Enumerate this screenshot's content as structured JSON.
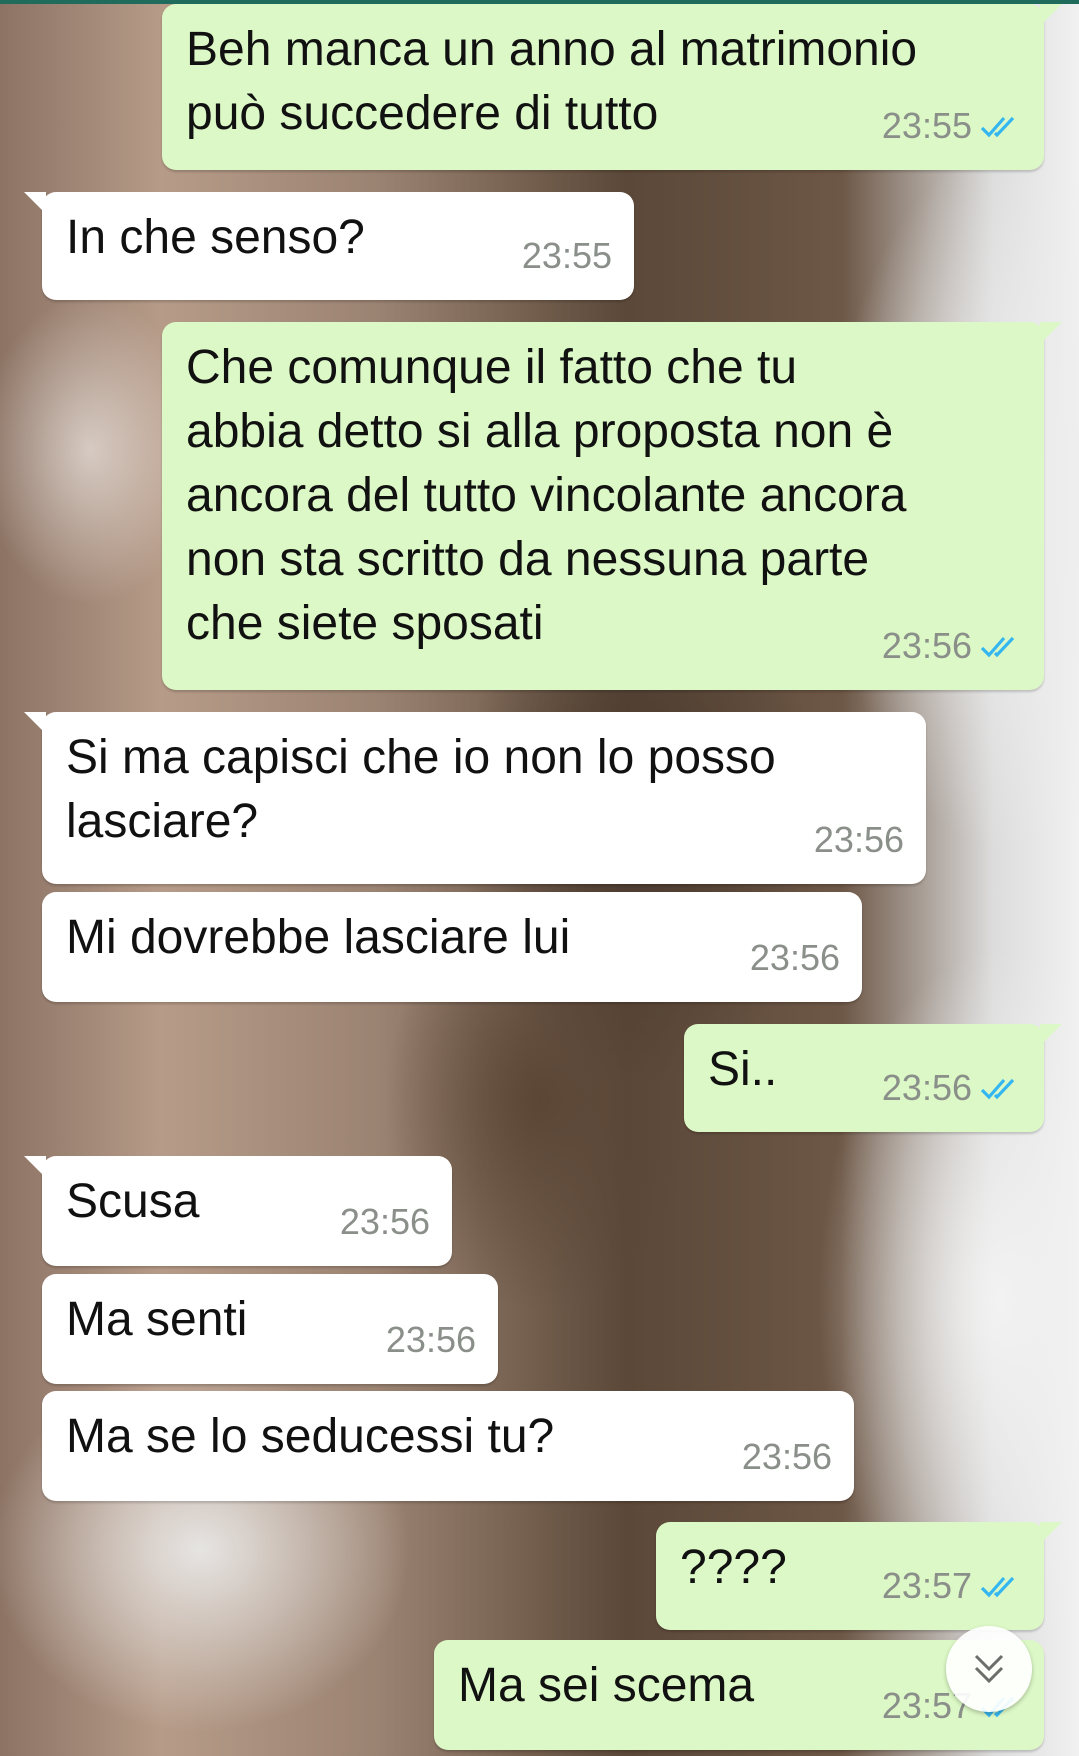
{
  "messages": [
    {
      "direction": "out",
      "text": "Beh manca un anno al matrimonio\npuò succedere di tutto",
      "time": "23:55",
      "status": "read"
    },
    {
      "direction": "in",
      "text": "In che senso?",
      "time": "23:55"
    },
    {
      "direction": "out",
      "text": "Che comunque il fatto che tu\nabbia detto si alla proposta non è\nancora del tutto vincolante ancora\nnon sta scritto da nessuna parte\nche siete sposati",
      "time": "23:56",
      "status": "read"
    },
    {
      "direction": "in",
      "text": "Si ma capisci che io non lo posso\nlasciare?",
      "time": "23:56"
    },
    {
      "direction": "in",
      "text": "Mi dovrebbe lasciare lui",
      "time": "23:56"
    },
    {
      "direction": "out",
      "text": "Si..",
      "time": "23:56",
      "status": "read"
    },
    {
      "direction": "in",
      "text": "Scusa",
      "time": "23:56"
    },
    {
      "direction": "in",
      "text": "Ma senti",
      "time": "23:56"
    },
    {
      "direction": "in",
      "text": "Ma se lo seducessi tu?",
      "time": "23:56"
    },
    {
      "direction": "out",
      "text": "????",
      "time": "23:57",
      "status": "read"
    },
    {
      "direction": "out",
      "text": "Ma sei scema",
      "time": "23:57",
      "status": "read"
    }
  ],
  "icons": {
    "read_receipt": "double-check-icon",
    "scroll_down": "chevron-down-double-icon"
  },
  "colors": {
    "outgoing_bubble": "#dcf8c6",
    "incoming_bubble": "#ffffff",
    "timestamp": "#8a8f8a",
    "read_ticks": "#34b7f1"
  }
}
